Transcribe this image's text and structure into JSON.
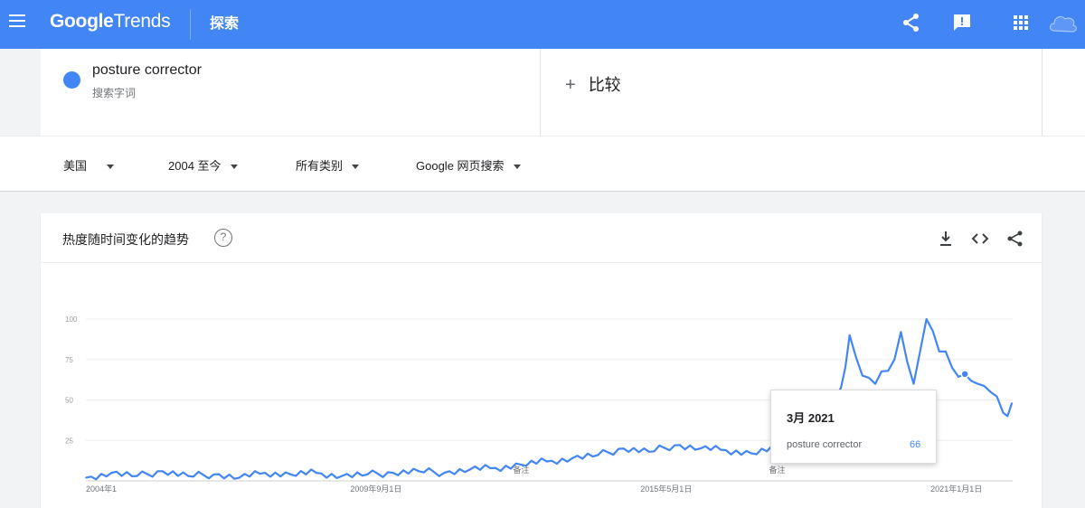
{
  "header": {
    "brand_bold": "Google",
    "brand_light": "Trends",
    "nav_explore": "探索",
    "icons": [
      "menu-icon",
      "share-icon",
      "feedback-icon",
      "apps-grid-icon",
      "account-avatar-icon"
    ],
    "accent_color": "#4285f4"
  },
  "search": {
    "term": "posture corrector",
    "term_sub": "搜索字词",
    "compare_label": "比较",
    "term_color": "#4285f4"
  },
  "filters": {
    "region": "美国",
    "period": "2004 至今",
    "category": "所有类别",
    "property": "Google 网页搜索"
  },
  "chart_card": {
    "title": "热度随时间变化的趋势",
    "help": "?",
    "icons": [
      "download-icon",
      "embed-code-icon",
      "share-icon"
    ]
  },
  "chart_data": {
    "type": "line",
    "series": [
      {
        "color": "#4285f4",
        "x": [
          "2004-01",
          "2004-07",
          "2005-01",
          "2005-07",
          "2006-01",
          "2006-07",
          "2007-01",
          "2007-07",
          "2008-01",
          "2008-07",
          "2009-01",
          "2009-07",
          "2010-01",
          "2010-07",
          "2011-01",
          "2011-07",
          "2012-01",
          "2012-07",
          "2013-01",
          "2013-07",
          "2014-01",
          "2014-07",
          "2015-01",
          "2015-07",
          "2016-01",
          "2016-07",
          "2017-01",
          "2017-07",
          "2018-01",
          "2018-07",
          "2018-10",
          "2018-12",
          "2019-03",
          "2019-06",
          "2019-09",
          "2019-12",
          "2020-03",
          "2020-06",
          "2020-09",
          "2020-12",
          "2021-03",
          "2021-06",
          "2021-09",
          "2021-12",
          "2022-02"
        ],
        "values": [
          2,
          5,
          3,
          6,
          3,
          4,
          2,
          5,
          4,
          5,
          3,
          4,
          5,
          6,
          5,
          7,
          8,
          10,
          12,
          14,
          16,
          20,
          18,
          22,
          20,
          19,
          17,
          20,
          24,
          30,
          58,
          90,
          65,
          60,
          68,
          92,
          60,
          100,
          80,
          70,
          66,
          60,
          55,
          42,
          48
        ]
      }
    ],
    "y_ticks": [
      "100",
      "75",
      "50",
      "25"
    ],
    "x_ticks": [
      "2004年1",
      "2009年9月1日",
      "2015年5月1日",
      "2021年1月1日"
    ],
    "annotations": [
      "备注",
      "备注"
    ],
    "ylim": [
      0,
      100
    ],
    "grid": true,
    "tooltip": {
      "date": "3月 2021",
      "term": "posture corrector",
      "value": "66"
    }
  }
}
